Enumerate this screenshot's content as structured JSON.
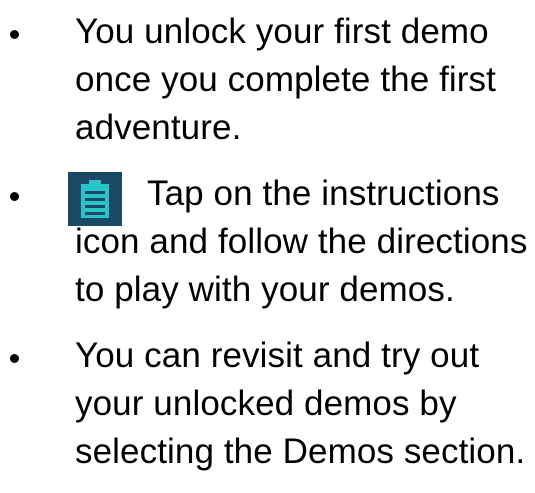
{
  "bullets": [
    {
      "text": "You unlock your first demo\nonce you complete the first\nadventure."
    },
    {
      "icon": "clipboard-instructions-icon",
      "text": "Tap on the instructions\nicon and follow the directions\nto play with your demos."
    },
    {
      "text": "You can revisit and try out\nyour unlocked demos by\nselecting the Demos section."
    }
  ],
  "colors": {
    "text": "#000000",
    "icon_background": "#1a4966",
    "icon_accent": "#29c4c9"
  }
}
